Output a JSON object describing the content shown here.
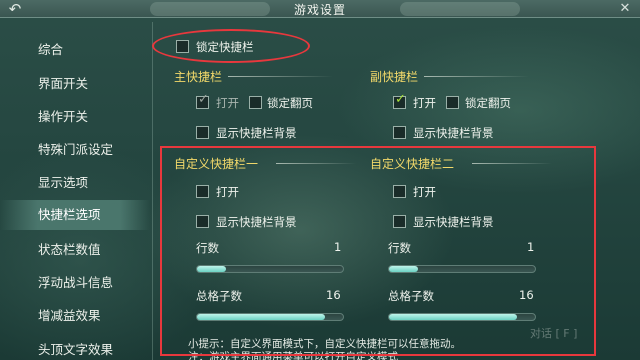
{
  "window": {
    "title": "游戏设置"
  },
  "sidebar": {
    "items": [
      {
        "label": "综合"
      },
      {
        "label": "界面开关"
      },
      {
        "label": "操作开关"
      },
      {
        "label": "特殊门派设定"
      },
      {
        "label": "显示选项"
      },
      {
        "label": "快捷栏选项",
        "active": true
      },
      {
        "label": "状态栏数值"
      },
      {
        "label": "浮动战斗信息"
      },
      {
        "label": "增减益效果"
      },
      {
        "label": "头顶文字效果"
      }
    ]
  },
  "lock_bar": {
    "label": "锁定快捷栏",
    "checked": false
  },
  "main_bar": {
    "title": "主快捷栏",
    "open_label": "打开",
    "open_checked": true,
    "lock_page_label": "锁定翻页",
    "lock_page_checked": false,
    "show_bg_label": "显示快捷栏背景",
    "show_bg_checked": false
  },
  "sub_bar": {
    "title": "副快捷栏",
    "open_label": "打开",
    "open_checked": true,
    "lock_page_label": "锁定翻页",
    "lock_page_checked": false,
    "show_bg_label": "显示快捷栏背景",
    "show_bg_checked": false
  },
  "custom_bar_1": {
    "title": "自定义快捷栏一",
    "open_label": "打开",
    "open_checked": false,
    "show_bg_label": "显示快捷栏背景",
    "show_bg_checked": false,
    "rows_label": "行数",
    "rows_value": "1",
    "rows_fraction": 0.2,
    "slots_label": "总格子数",
    "slots_value": "16",
    "slots_fraction": 0.88
  },
  "custom_bar_2": {
    "title": "自定义快捷栏二",
    "open_label": "打开",
    "open_checked": false,
    "show_bg_label": "显示快捷栏背景",
    "show_bg_checked": false,
    "rows_label": "行数",
    "rows_value": "1",
    "rows_fraction": 0.2,
    "slots_label": "总格子数",
    "slots_value": "16",
    "slots_fraction": 0.88
  },
  "tips": {
    "line1": "小提示：自定义界面模式下，自定义快捷栏可以任意拖动。",
    "line2": "注：游戏主界面通用菜单可以打开自定义模式"
  },
  "watermark": "对话 [ F ]",
  "colors": {
    "annotation": "#e8383d",
    "section_title": "#f2d96a",
    "check": "#a8e23a"
  }
}
